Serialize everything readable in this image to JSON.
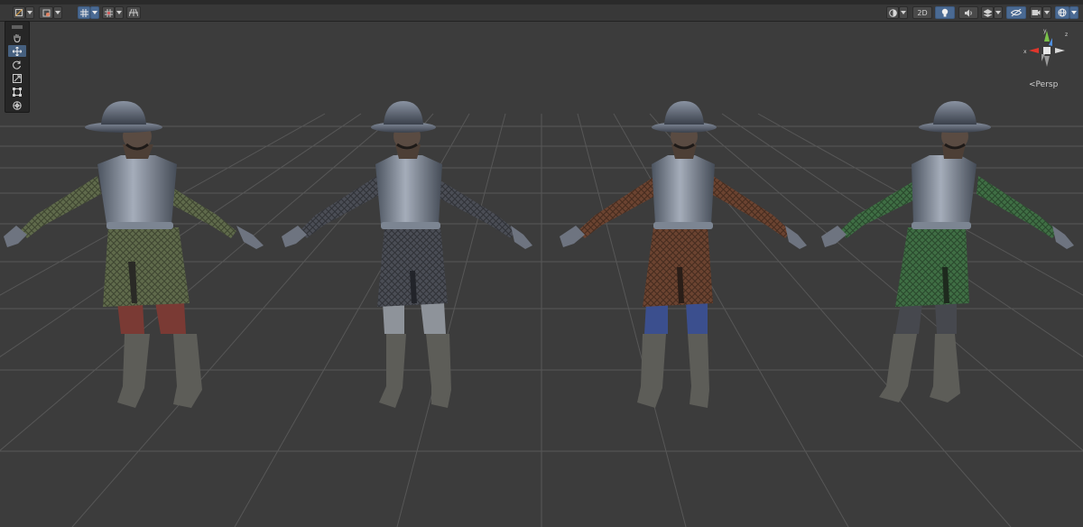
{
  "toolbar": {
    "dim_2d_label": "2D",
    "buttons": [
      "draw-mode",
      "render-mode",
      "grid-snap",
      "snap-increment",
      "toggle-grid",
      "shading-dropdown",
      "2d-toggle",
      "lighting-toggle",
      "audio-toggle",
      "effects-dropdown",
      "visibility-toggle",
      "camera-dropdown",
      "gizmos-dropdown"
    ]
  },
  "tools": [
    "view-tool",
    "move-tool",
    "rotate-tool",
    "scale-tool",
    "rect-tool",
    "transform-tool"
  ],
  "gizmo": {
    "axis_x": "x",
    "axis_y": "y",
    "axis_z": "z",
    "projection_label": "Persp"
  },
  "characters": [
    {
      "name": "soldier-olive",
      "tunic_color": "#5f6a4b",
      "pants_color": "#7a3a34",
      "boot_color": "#5d5d58"
    },
    {
      "name": "soldier-grey",
      "tunic_color": "#4a4d55",
      "pants_color": "#8e939a",
      "boot_color": "#5d5d58"
    },
    {
      "name": "soldier-brown",
      "tunic_color": "#6b4330",
      "pants_color": "#3b4f8e",
      "boot_color": "#5d5d58"
    },
    {
      "name": "soldier-green",
      "tunic_color": "#3f6e44",
      "pants_color": "#46484e",
      "boot_color": "#5d5d58"
    }
  ],
  "colors": {
    "viewport_bg": "#3c3c3c",
    "grid_line": "#565656",
    "active_button": "#4a6a93"
  }
}
